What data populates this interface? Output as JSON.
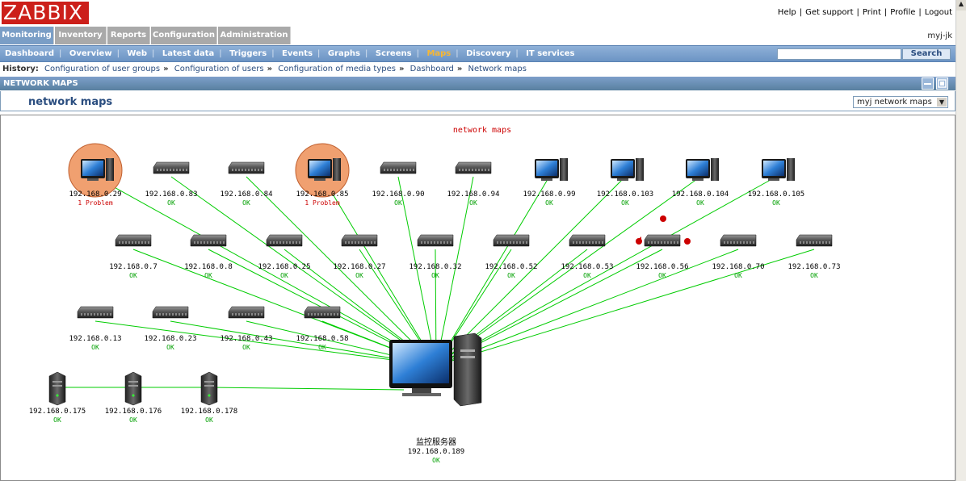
{
  "logo": "ZABBIX",
  "top_links": [
    "Help",
    "Get support",
    "Print",
    "Profile",
    "Logout"
  ],
  "main_menu": [
    "Monitoring",
    "Inventory",
    "Reports",
    "Configuration",
    "Administration"
  ],
  "user": "myj-jk",
  "sub_menu": [
    "Dashboard",
    "Overview",
    "Web",
    "Latest data",
    "Triggers",
    "Events",
    "Graphs",
    "Screens",
    "Maps",
    "Discovery",
    "IT services"
  ],
  "sub_menu_selected": "Maps",
  "search": {
    "value": "",
    "button": "Search"
  },
  "history": {
    "label": "History:",
    "items": [
      "Configuration of user groups",
      "Configuration of users",
      "Configuration of media types",
      "Dashboard",
      "Network maps"
    ]
  },
  "section_header": "NETWORK MAPS",
  "page_title": "network maps",
  "map_select": "myj network maps",
  "map": {
    "title": "network maps",
    "center": {
      "name": "监控服务器",
      "ip": "192.168.0.189",
      "status": "OK"
    },
    "hosts": [
      {
        "ip": "192.168.0.29",
        "status": "1 Problem",
        "type": "pc",
        "problem": true
      },
      {
        "ip": "192.168.0.83",
        "status": "OK",
        "type": "switch"
      },
      {
        "ip": "192.168.0.84",
        "status": "OK",
        "type": "switch"
      },
      {
        "ip": "192.168.0.85",
        "status": "1 Problem",
        "type": "pc",
        "problem": true
      },
      {
        "ip": "192.168.0.90",
        "status": "OK",
        "type": "switch"
      },
      {
        "ip": "192.168.0.94",
        "status": "OK",
        "type": "switch"
      },
      {
        "ip": "192.168.0.99",
        "status": "OK",
        "type": "pc"
      },
      {
        "ip": "192.168.0.103",
        "status": "OK",
        "type": "pc"
      },
      {
        "ip": "192.168.0.104",
        "status": "OK",
        "type": "pc"
      },
      {
        "ip": "192.168.0.105",
        "status": "OK",
        "type": "pc"
      },
      {
        "ip": "192.168.0.7",
        "status": "OK",
        "type": "switch"
      },
      {
        "ip": "192.168.0.8",
        "status": "OK",
        "type": "switch"
      },
      {
        "ip": "192.168.0.25",
        "status": "OK",
        "type": "switch"
      },
      {
        "ip": "192.168.0.27",
        "status": "OK",
        "type": "switch"
      },
      {
        "ip": "192.168.0.32",
        "status": "OK",
        "type": "switch"
      },
      {
        "ip": "192.168.0.52",
        "status": "OK",
        "type": "switch"
      },
      {
        "ip": "192.168.0.53",
        "status": "OK",
        "type": "switch"
      },
      {
        "ip": "192.168.0.56",
        "status": "OK",
        "type": "switch",
        "selected": true
      },
      {
        "ip": "192.168.0.70",
        "status": "OK",
        "type": "switch"
      },
      {
        "ip": "192.168.0.73",
        "status": "OK",
        "type": "switch"
      },
      {
        "ip": "192.168.0.13",
        "status": "OK",
        "type": "switch"
      },
      {
        "ip": "192.168.0.23",
        "status": "OK",
        "type": "switch"
      },
      {
        "ip": "192.168.0.43",
        "status": "OK",
        "type": "switch"
      },
      {
        "ip": "192.168.0.58",
        "status": "OK",
        "type": "switch"
      },
      {
        "ip": "192.168.0.175",
        "status": "OK",
        "type": "server"
      },
      {
        "ip": "192.168.0.176",
        "status": "OK",
        "type": "server"
      },
      {
        "ip": "192.168.0.178",
        "status": "OK",
        "type": "server"
      }
    ]
  },
  "colors": {
    "ok": "#00a000",
    "problem": "#cc0000",
    "link": "#00cc00",
    "logo": "#cc1f1a",
    "accent": "#6c94c4"
  }
}
